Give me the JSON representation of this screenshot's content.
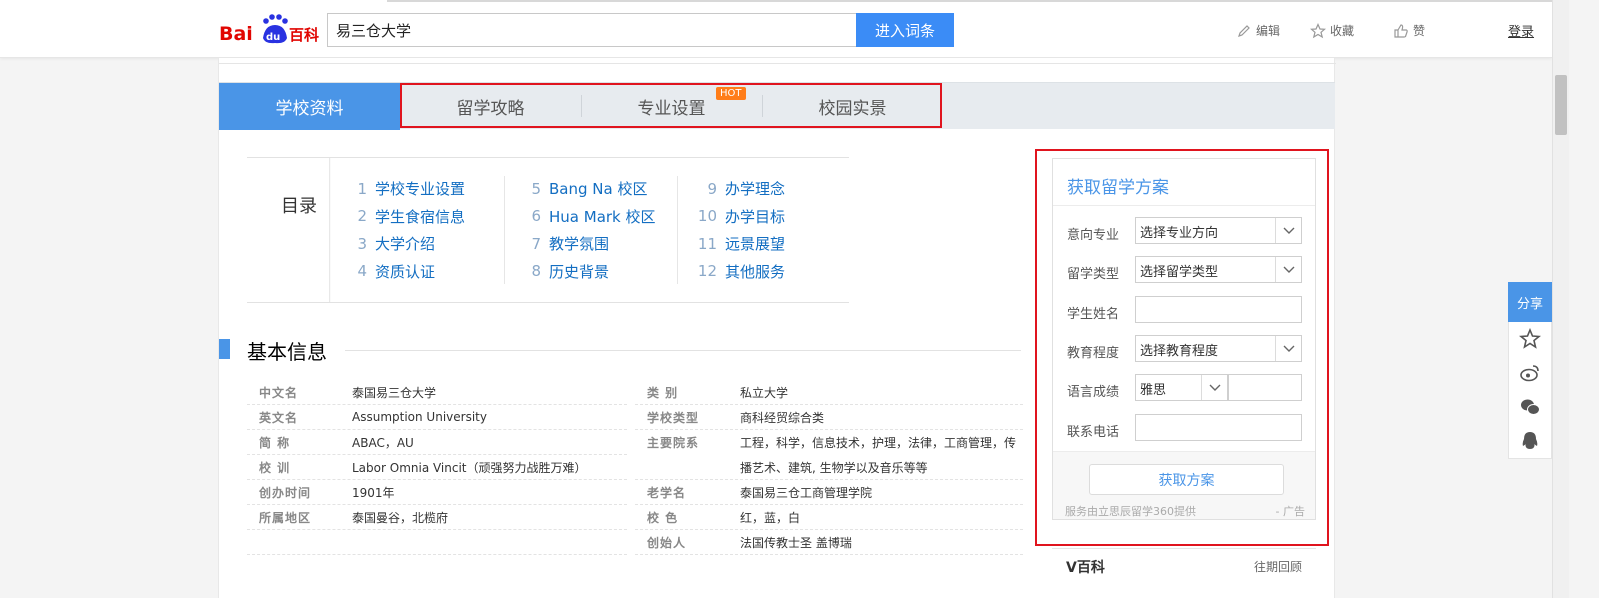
{
  "header": {
    "logo_text": "Bai du 百科",
    "search_value": "易三仓大学",
    "search_button": "进入词条",
    "actions": [
      {
        "label": "编辑",
        "icon": "pencil-icon"
      },
      {
        "label": "收藏",
        "icon": "star-icon"
      },
      {
        "label": "赞",
        "icon": "thumbs-up-icon"
      }
    ],
    "login": "登录"
  },
  "tabs": [
    {
      "label": "学校资料",
      "active": true
    },
    {
      "label": "留学攻略",
      "active": false
    },
    {
      "label": "专业设置",
      "active": false,
      "badge": "HOT"
    },
    {
      "label": "校园实景",
      "active": false
    }
  ],
  "toc": {
    "title": "目录",
    "columns": [
      [
        {
          "num": "1",
          "label": "学校专业设置"
        },
        {
          "num": "2",
          "label": "学生食宿信息"
        },
        {
          "num": "3",
          "label": "大学介绍"
        },
        {
          "num": "4",
          "label": "资质认证"
        }
      ],
      [
        {
          "num": "5",
          "label": "Bang Na 校区"
        },
        {
          "num": "6",
          "label": "Hua Mark 校区"
        },
        {
          "num": "7",
          "label": "教学氛围"
        },
        {
          "num": "8",
          "label": "历史背景"
        }
      ],
      [
        {
          "num": "9",
          "label": "办学理念"
        },
        {
          "num": "10",
          "label": "办学目标"
        },
        {
          "num": "11",
          "label": "远景展望"
        },
        {
          "num": "12",
          "label": "其他服务"
        }
      ]
    ]
  },
  "basic_info": {
    "title": "基本信息",
    "left": [
      {
        "key": "中文名",
        "value": "泰国易三仓大学"
      },
      {
        "key": "英文名",
        "value": "Assumption University"
      },
      {
        "key": "简 称",
        "value": "ABAC，AU"
      },
      {
        "key": "校 训",
        "value": "Labor Omnia Vincit（顽强努力战胜万难）"
      },
      {
        "key": "创办时间",
        "value": "1901年"
      },
      {
        "key": "所属地区",
        "value": "泰国曼谷，北榄府"
      },
      {
        "key": "",
        "value": ""
      }
    ],
    "right": [
      {
        "key": "类 别",
        "value": "私立大学"
      },
      {
        "key": "学校类型",
        "value": "商科经贸综合类"
      },
      {
        "key": "主要院系",
        "value": "工程，科学，信息技术，护理，法律，工商管理，传"
      },
      {
        "key": "",
        "value": "播艺术、建筑, 生物学以及音乐等等"
      },
      {
        "key": "老学名",
        "value": "泰国易三仓工商管理学院"
      },
      {
        "key": "校 色",
        "value": "红，蓝，白"
      },
      {
        "key": "创始人",
        "value": "法国传教士圣 盖博瑞"
      }
    ]
  },
  "form": {
    "title": "获取留学方案",
    "fields": [
      {
        "label": "意向专业",
        "type": "select",
        "value": "选择专业方向"
      },
      {
        "label": "留学类型",
        "type": "select",
        "value": "选择留学类型"
      },
      {
        "label": "学生姓名",
        "type": "input",
        "value": ""
      },
      {
        "label": "教育程度",
        "type": "select",
        "value": "选择教育程度"
      },
      {
        "label": "语言成绩",
        "type": "select-input",
        "value": "雅思"
      },
      {
        "label": "联系电话",
        "type": "input",
        "value": ""
      }
    ],
    "submit": "获取方案",
    "provided_by": "服务由立思辰留学360提供",
    "ad": "- 广告"
  },
  "vbaike": {
    "title": "V百科",
    "more": "往期回顾"
  },
  "share": {
    "label": "分享",
    "icons": [
      "qzone-star-icon",
      "weibo-icon",
      "wechat-icon",
      "qq-penguin-icon"
    ]
  },
  "colors": {
    "brand_blue": "#4a95e7",
    "search_button": "#3b8cf6",
    "link_blue": "#136ec2",
    "hot_badge": "#ff7d19",
    "highlight_red": "#e0141e",
    "logo_red": "#e10602",
    "logo_blue": "#2932e1"
  }
}
